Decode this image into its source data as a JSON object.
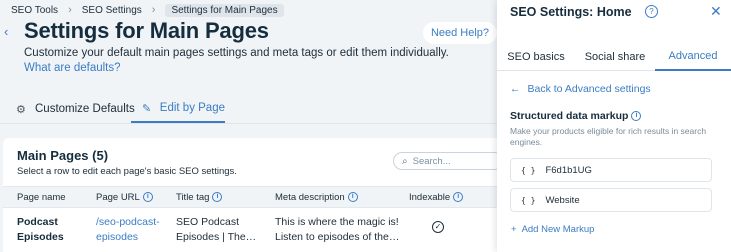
{
  "breadcrumb": [
    "SEO Tools",
    "SEO Settings",
    "Settings for Main Pages"
  ],
  "page": {
    "title": "Settings for Main Pages",
    "description": "Customize your default main pages settings and meta tags or edit them individually.",
    "defaults_link": "What are defaults?",
    "help_button": "Need Help?"
  },
  "tabs": {
    "customize": "Customize Defaults",
    "edit": "Edit by Page"
  },
  "table": {
    "title": "Main Pages (5)",
    "subtitle": "Select a row to edit each page's basic SEO settings.",
    "search_placeholder": "Search...",
    "columns": [
      "Page name",
      "Page URL",
      "Title tag",
      "Meta description",
      "Indexable"
    ],
    "row": {
      "name_line1": "Podcast",
      "name_line2": "Episodes",
      "url_line1": "/seo-podcast-",
      "url_line2": "episodes",
      "title_line1": "SEO Podcast",
      "title_line2": "Episodes | The…",
      "meta_line1": "This is where the magic is!",
      "meta_line2": "Listen to episodes of the…"
    }
  },
  "panel": {
    "title": "SEO Settings: Home",
    "tabs": [
      "SEO basics",
      "Social share",
      "Advanced"
    ],
    "active_tab": "Advanced",
    "back_link": "Back to Advanced settings",
    "section_title": "Structured data markup",
    "section_desc": "Make your products eligible for rich results in search engines.",
    "markups": [
      "F6d1b1UG",
      "Website"
    ],
    "add_markup": "Add New Markup"
  },
  "colors": {
    "accent": "#3b7cc4",
    "background": "#f0f4f7",
    "text": "#162d3d"
  }
}
